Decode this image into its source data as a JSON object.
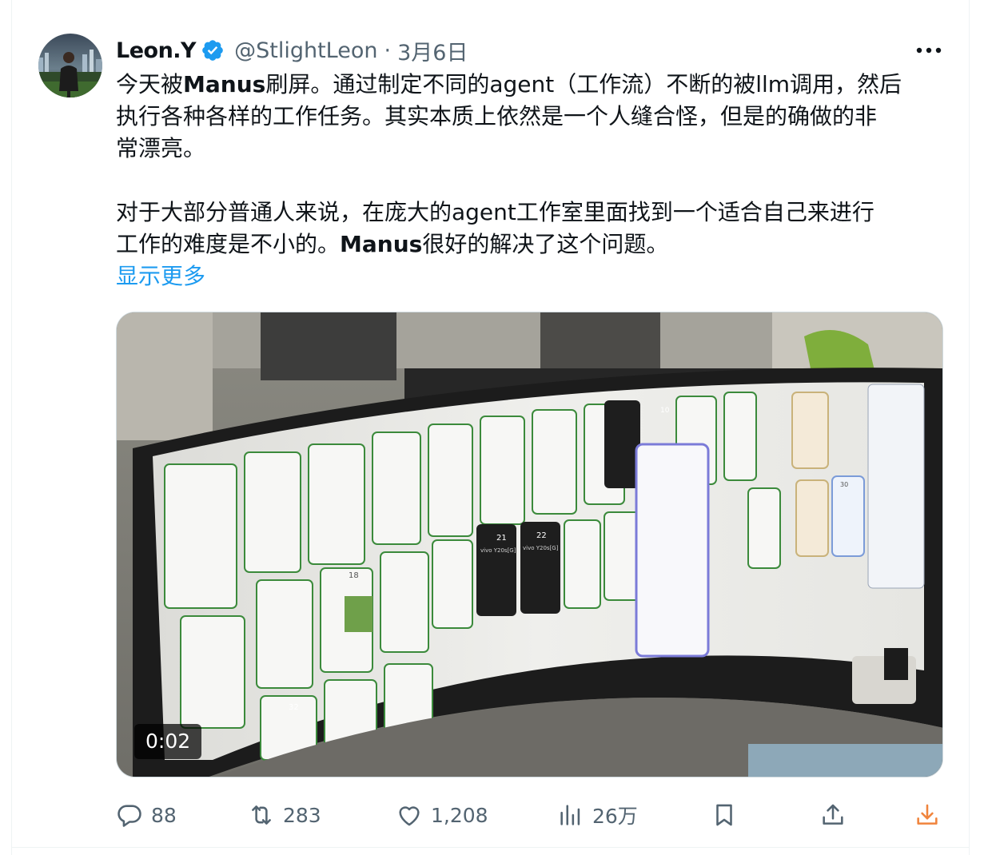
{
  "tweet": {
    "author_name": "Leon.Y",
    "handle": "@StlightLeon",
    "separator": "·",
    "time": "3月6日",
    "text_lines": [
      [
        "今天被",
        "Manus",
        "刷屏。通过制定不同的agent（工作流）不断的被llm调用，然后"
      ],
      [
        "执行各种各样的工作任务。其实本质上依然是一个人缝合怪，但是的确做的非"
      ],
      [
        "常漂亮。"
      ],
      [],
      [
        "对于大部分普通人来说，在庞大的agent工作室里面找到一个适合自己来进行"
      ],
      [
        "工作的难度是不小的。",
        "Manus",
        "很好的解决了这个问题。"
      ]
    ],
    "show_more": "显示更多"
  },
  "media": {
    "video_time": "0:02",
    "monitor_labels": [
      "vivo Y20s[G]",
      "vivo Y20s[G]",
      "21",
      "22",
      "18",
      "32",
      "30",
      "10"
    ]
  },
  "actions": {
    "replies": "88",
    "reposts": "283",
    "likes": "1,208",
    "views": "26万"
  },
  "colors": {
    "accent": "#1d9bf0",
    "muted": "#536471",
    "text": "#0f1419",
    "download": "#f0843c"
  },
  "icons": [
    "verified-badge-icon",
    "more-icon",
    "reply-icon",
    "repost-icon",
    "like-icon",
    "views-icon",
    "bookmark-icon",
    "share-icon",
    "download-icon"
  ]
}
